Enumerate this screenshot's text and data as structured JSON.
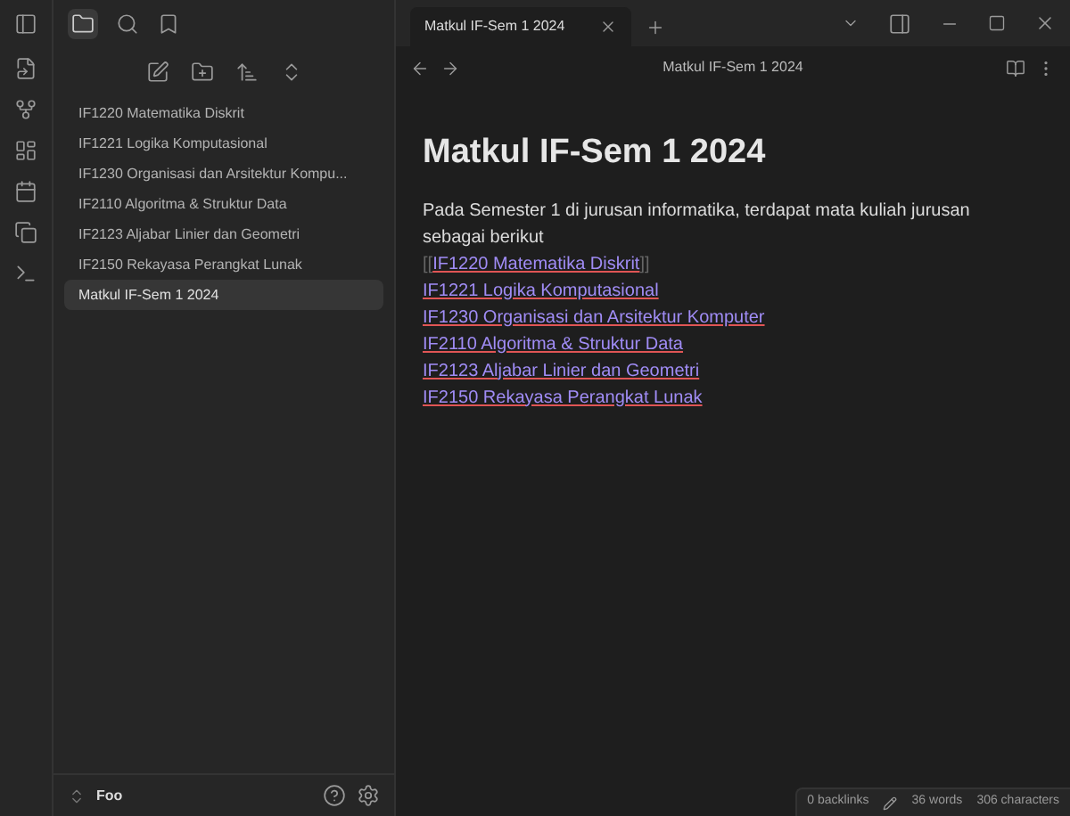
{
  "sidebar": {
    "files": [
      {
        "name": "IF1220 Matematika Diskrit",
        "selected": false
      },
      {
        "name": "IF1221 Logika Komputasional",
        "selected": false
      },
      {
        "name": "IF1230 Organisasi dan Arsitektur Kompu...",
        "selected": false
      },
      {
        "name": "IF2110 Algoritma & Struktur Data",
        "selected": false
      },
      {
        "name": "IF2123 Aljabar Linier dan Geometri",
        "selected": false
      },
      {
        "name": "IF2150 Rekayasa Perangkat Lunak",
        "selected": false
      },
      {
        "name": "Matkul IF-Sem 1 2024",
        "selected": true
      }
    ],
    "vault": "Foo"
  },
  "tabs": [
    {
      "label": "Matkul IF-Sem 1 2024",
      "selected": true
    }
  ],
  "note": {
    "breadcrumb": "Matkul IF-Sem 1 2024",
    "title": "Matkul IF-Sem 1 2024",
    "paragraph": "Pada Semester 1 di jurusan informatika, terdapat mata kuliah jurusan sebagai berikut",
    "links": [
      {
        "kind": "raw",
        "open": "[[",
        "text": "IF1220 Matematika Diskrit",
        "close": "]]"
      },
      {
        "kind": "link",
        "text": "IF1221 Logika Komputasional"
      },
      {
        "kind": "link",
        "text": "IF1230 Organisasi dan Arsitektur Komputer"
      },
      {
        "kind": "link",
        "text": "IF2110 Algoritma & Struktur Data"
      },
      {
        "kind": "link",
        "text": "IF2123 Aljabar Linier dan Geometri"
      },
      {
        "kind": "link",
        "text": "IF2150 Rekayasa Perangkat Lunak"
      }
    ]
  },
  "status_bar": {
    "backlinks": "0 backlinks",
    "words": "36 words",
    "characters": "306 characters"
  }
}
